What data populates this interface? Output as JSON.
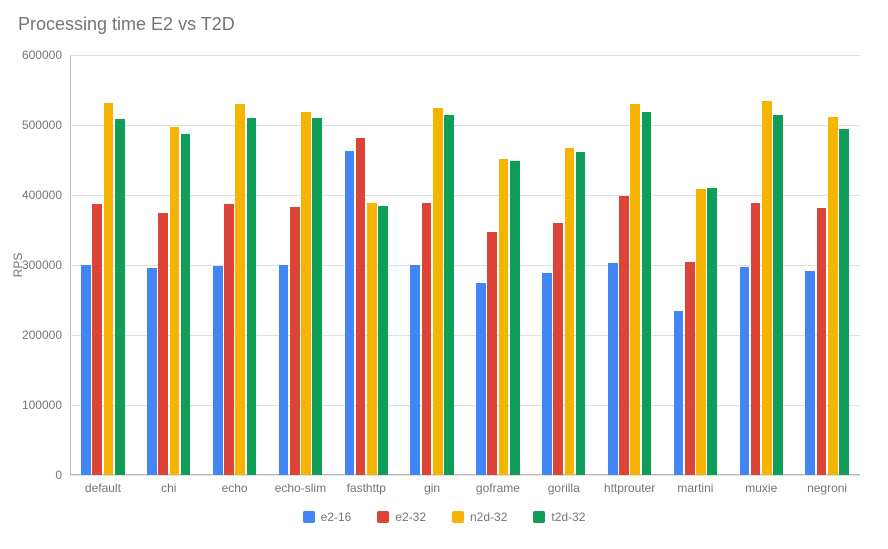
{
  "chart_data": {
    "type": "bar",
    "title": "Processing time E2 vs T2D",
    "ylabel": "RPS",
    "xlabel": "",
    "ylim": [
      0,
      600000
    ],
    "y_ticks": [
      0,
      100000,
      200000,
      300000,
      400000,
      500000,
      600000
    ],
    "categories": [
      "default",
      "chi",
      "echo",
      "echo-slim",
      "fasthttp",
      "gin",
      "goframe",
      "gorilla",
      "httprouter",
      "martini",
      "muxie",
      "negroni"
    ],
    "series": [
      {
        "name": "e2-16",
        "color": "#4285F4",
        "values": [
          300000,
          296000,
          298000,
          300000,
          463000,
          300000,
          275000,
          289000,
          303000,
          234000,
          297000,
          292000
        ]
      },
      {
        "name": "e2-32",
        "color": "#DB4437",
        "values": [
          387000,
          375000,
          387000,
          383000,
          482000,
          388000,
          347000,
          360000,
          398000,
          304000,
          388000,
          382000
        ]
      },
      {
        "name": "n2d-32",
        "color": "#F4B400",
        "values": [
          532000,
          497000,
          530000,
          518000,
          388000,
          525000,
          452000,
          467000,
          530000,
          408000,
          535000,
          511000
        ]
      },
      {
        "name": "t2d-32",
        "color": "#0F9D58",
        "values": [
          509000,
          487000,
          510000,
          510000,
          385000,
          514000,
          448000,
          461000,
          519000,
          410000,
          514000,
          494000
        ]
      }
    ]
  }
}
